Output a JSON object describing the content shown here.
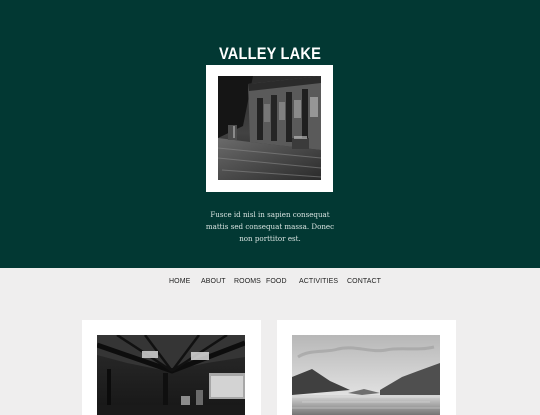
{
  "site": {
    "title": "VALLEY LAKE",
    "tagline": "Fusce id nisl in sapien consequat mattis sed consequat massa. Donec non porttitor est."
  },
  "nav": {
    "items": [
      {
        "label": "HOME"
      },
      {
        "label": "ABOUT"
      },
      {
        "label": "ROOMS"
      },
      {
        "label": "FOOD"
      },
      {
        "label": "ACTIVITIES"
      },
      {
        "label": "CONTACT"
      }
    ]
  },
  "colors": {
    "hero_background": "#023833",
    "page_background": "#efeeee",
    "card_background": "#ffffff",
    "nav_text": "#222222"
  },
  "images": {
    "hero_photo": "lodge-porch-photo",
    "card_photos": [
      "wooden-ceiling-interior-photo",
      "mountain-lake-photo"
    ]
  }
}
